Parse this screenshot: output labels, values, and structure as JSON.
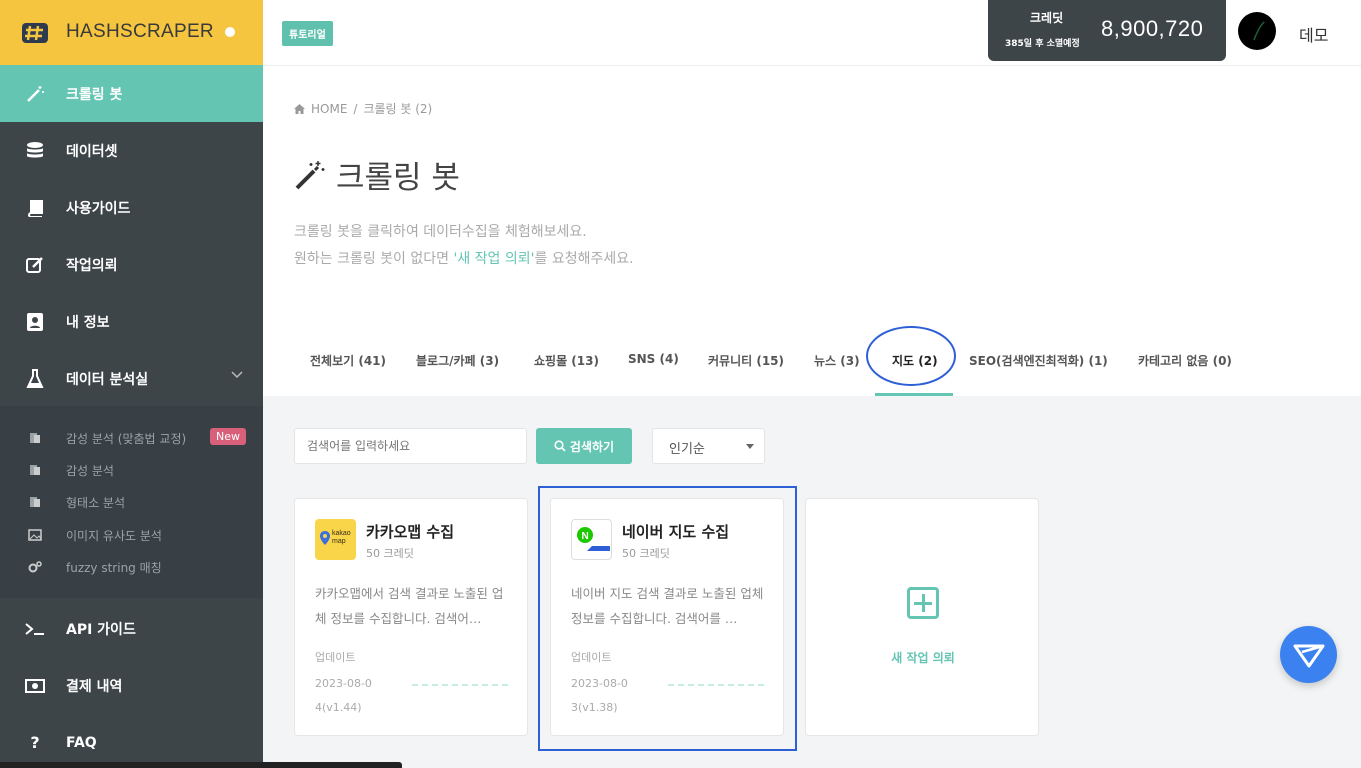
{
  "sidebar": {
    "brand": "HASHSCRAPER",
    "items": [
      {
        "label": "크롤링 봇",
        "icon": "wand-icon"
      },
      {
        "label": "데이터셋",
        "icon": "database-icon"
      },
      {
        "label": "사용가이드",
        "icon": "book-icon"
      },
      {
        "label": "작업의뢰",
        "icon": "edit-icon"
      },
      {
        "label": "내 정보",
        "icon": "user-card-icon"
      },
      {
        "label": "데이터 분석실",
        "icon": "flask-icon"
      }
    ],
    "sub_items": [
      {
        "label": "감성 분석 (맞춤법 교정)",
        "badge": "New"
      },
      {
        "label": "감성 분석"
      },
      {
        "label": "형태소 분석"
      },
      {
        "label": "이미지 유사도 분석"
      },
      {
        "label": "fuzzy string 매칭"
      }
    ],
    "bottom_items": [
      {
        "label": "API 가이드",
        "icon": "terminal-icon"
      },
      {
        "label": "결제 내역",
        "icon": "money-icon"
      },
      {
        "label": "FAQ",
        "icon": "question-icon"
      }
    ]
  },
  "header": {
    "tutorial_label": "튜토리얼",
    "credit_label": "크레딧",
    "credit_expiry": "385일 후 소멸예정",
    "credit_value": "8,900,720",
    "user_name": "데모"
  },
  "breadcrumb": {
    "home": "HOME",
    "sep": "/",
    "current": "크롤링 봇 (2)"
  },
  "page": {
    "title": "크롤링 봇",
    "desc_line1": "크롤링 봇을 클릭하여 데이터수집을 체험해보세요.",
    "desc_line2_pre": "원하는 크롤링 봇이 없다면 ",
    "desc_line2_link": "'새 작업 의뢰'",
    "desc_line2_post": "를 요청해주세요."
  },
  "tabs": [
    "전체보기 (41)",
    "블로그/카페 (3)",
    "쇼핑몰 (13)",
    "SNS (4)",
    "커뮤니티 (15)",
    "뉴스 (3)",
    "지도 (2)",
    "SEO(검색엔진최적화) (1)",
    "카테고리 없음 (0)"
  ],
  "active_tab": "지도 (2)",
  "search": {
    "placeholder": "검색어를 입력하세요",
    "button": "검색하기",
    "sort": "인기순"
  },
  "cards": [
    {
      "title": "카카오맵 수집",
      "credit": "50 크레딧",
      "desc": "카카오맵에서 검색 결과로 노출된 업체 정보를 수집합니다. 검색어…",
      "update_label": "업데이트",
      "update_date": "2023-08-04(v1.44)",
      "logo_text": "kakao map",
      "logo_color": "#f9d649"
    },
    {
      "title": "네이버 지도 수집",
      "credit": "50 크레딧",
      "desc": "네이버 지도 검색 결과로 노출된 업체 정보를 수집합니다. 검색어를 …",
      "update_label": "업데이트",
      "update_date": "2023-08-03(v1.38)",
      "logo_text": "N",
      "logo_color": "#ffffff"
    }
  ],
  "new_request": {
    "label": "새 작업 의뢰"
  },
  "colors": {
    "accent": "#64c5b3",
    "brand": "#f5c53f",
    "sidebar": "#3e4549",
    "annotation": "#2f5fd6"
  }
}
